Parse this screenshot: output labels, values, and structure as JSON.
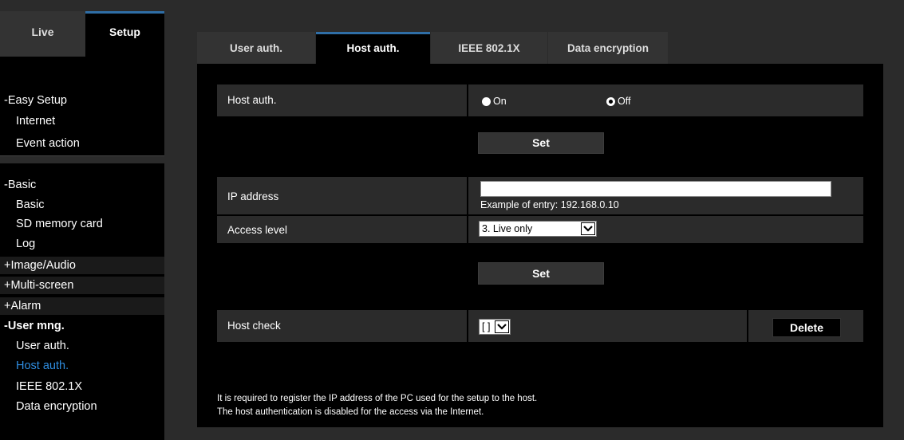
{
  "top_tabs": {
    "live": "Live",
    "setup": "Setup"
  },
  "sidebar": {
    "easy_setup": "-Easy Setup",
    "internet": "Internet",
    "event_action": "Event action",
    "basic_group": "-Basic",
    "basic": "Basic",
    "sd_memory_card": "SD memory card",
    "log": "Log",
    "image_audio": "+Image/Audio",
    "multi_screen": "+Multi-screen",
    "alarm": "+Alarm",
    "user_mng": "-User mng.",
    "user_auth": "User auth.",
    "host_auth": "Host auth.",
    "ieee": "IEEE 802.1X",
    "data_encryption": "Data encryption"
  },
  "page_tabs": {
    "user_auth": "User auth.",
    "host_auth": "Host auth.",
    "ieee": "IEEE 802.1X",
    "data_encryption": "Data encryption"
  },
  "form": {
    "host_auth_label": "Host auth.",
    "on_label": "On",
    "off_label": "Off",
    "host_auth_value": "Off",
    "set_label": "Set",
    "ip_address_label": "IP address",
    "ip_address_value": "",
    "ip_hint": "Example of entry: 192.168.0.10",
    "access_level_label": "Access level",
    "access_level_value": "3. Live only",
    "set2_label": "Set",
    "host_check_label": "Host check",
    "host_check_value": "[ ]",
    "delete_label": "Delete"
  },
  "notes": {
    "line1": "It is required to register the IP address of the PC used for the setup to the host.",
    "line2": "The host authentication is disabled for the access via the Internet."
  },
  "colors": {
    "accent": "#2f6ea6",
    "active_link": "#2f8de0",
    "bg": "#2b2b2b",
    "panel": "#000000"
  }
}
